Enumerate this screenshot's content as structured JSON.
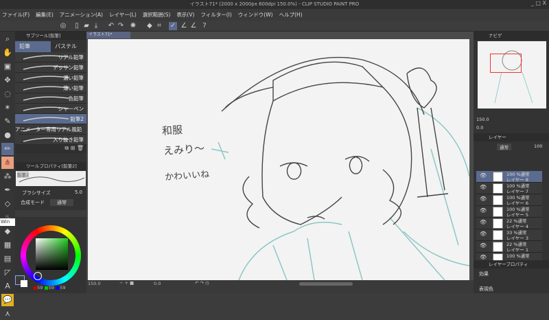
{
  "window": {
    "title": "イラスト71* (2000 x 2000px 600dpi 150.0%) - CLIP STUDIO PAINT PRO",
    "controls": "_ □ X"
  },
  "menu": [
    "ファイル(F)",
    "編集(E)",
    "アニメーション(A)",
    "レイヤー(L)",
    "選択範囲(S)",
    "表示(V)",
    "フィルター(I)",
    "ウィンドウ(W)",
    "ヘルプ(H)"
  ],
  "subtool": {
    "header": "サブツール[鉛筆]",
    "tabs": [
      "鉛筆",
      "パステル"
    ],
    "brushes": [
      "リアル鉛筆",
      "デッサン鉛筆",
      "濃い鉛筆",
      "薄い鉛筆",
      "色鉛筆",
      "シャーペン",
      "鉛筆2",
      "アニメーター専用リアル風鉛筆",
      "入り抜き鉛筆"
    ],
    "selected": "鉛筆2"
  },
  "toolprop": {
    "header": "ツールプロパティ[鉛筆2]",
    "preview_label": "鉛筆2",
    "brush_size_label": "ブラシサイズ",
    "brush_size": "5.0",
    "blend_label": "合成モード",
    "blend_value": "通常"
  },
  "tooltip": "Win",
  "color": {
    "r": "59",
    "g": "59",
    "b": "59",
    "main": "#3b3b3b",
    "sub": "#ffffff",
    "hue_accent": "#22cc44"
  },
  "document": {
    "tab": "イラスト71*"
  },
  "canvas_text": {
    "line1": "和服",
    "line2": "えみり〜",
    "line3": "かわいいね"
  },
  "status": {
    "zoom": "150.0",
    "angle": "0.0"
  },
  "navigator": {
    "tab": "ナビゲ",
    "zoom": "150.0",
    "angle": "0.0"
  },
  "layers": {
    "tab": "レイヤー",
    "blend": "通常",
    "opacity": "100",
    "items": [
      {
        "opacity": "100 %",
        "mode": "通常",
        "name": "レイヤー 8",
        "selected": true
      },
      {
        "opacity": "100 %",
        "mode": "通常",
        "name": "レイヤー 7"
      },
      {
        "opacity": "100 %",
        "mode": "通常",
        "name": "レイヤー 6"
      },
      {
        "opacity": "100 %",
        "mode": "通常",
        "name": "レイヤー 5"
      },
      {
        "opacity": "22 %",
        "mode": "通常",
        "name": "レイヤー 4"
      },
      {
        "opacity": "33 %",
        "mode": "通常",
        "name": "レイヤー 3"
      },
      {
        "opacity": "22 %",
        "mode": "通常",
        "name": "レイヤー 1"
      },
      {
        "opacity": "100 %",
        "mode": "通常",
        "name": ""
      }
    ]
  },
  "layerprop": {
    "tab": "レイヤープロパティ",
    "effect": "効果",
    "expression": "表現色"
  }
}
